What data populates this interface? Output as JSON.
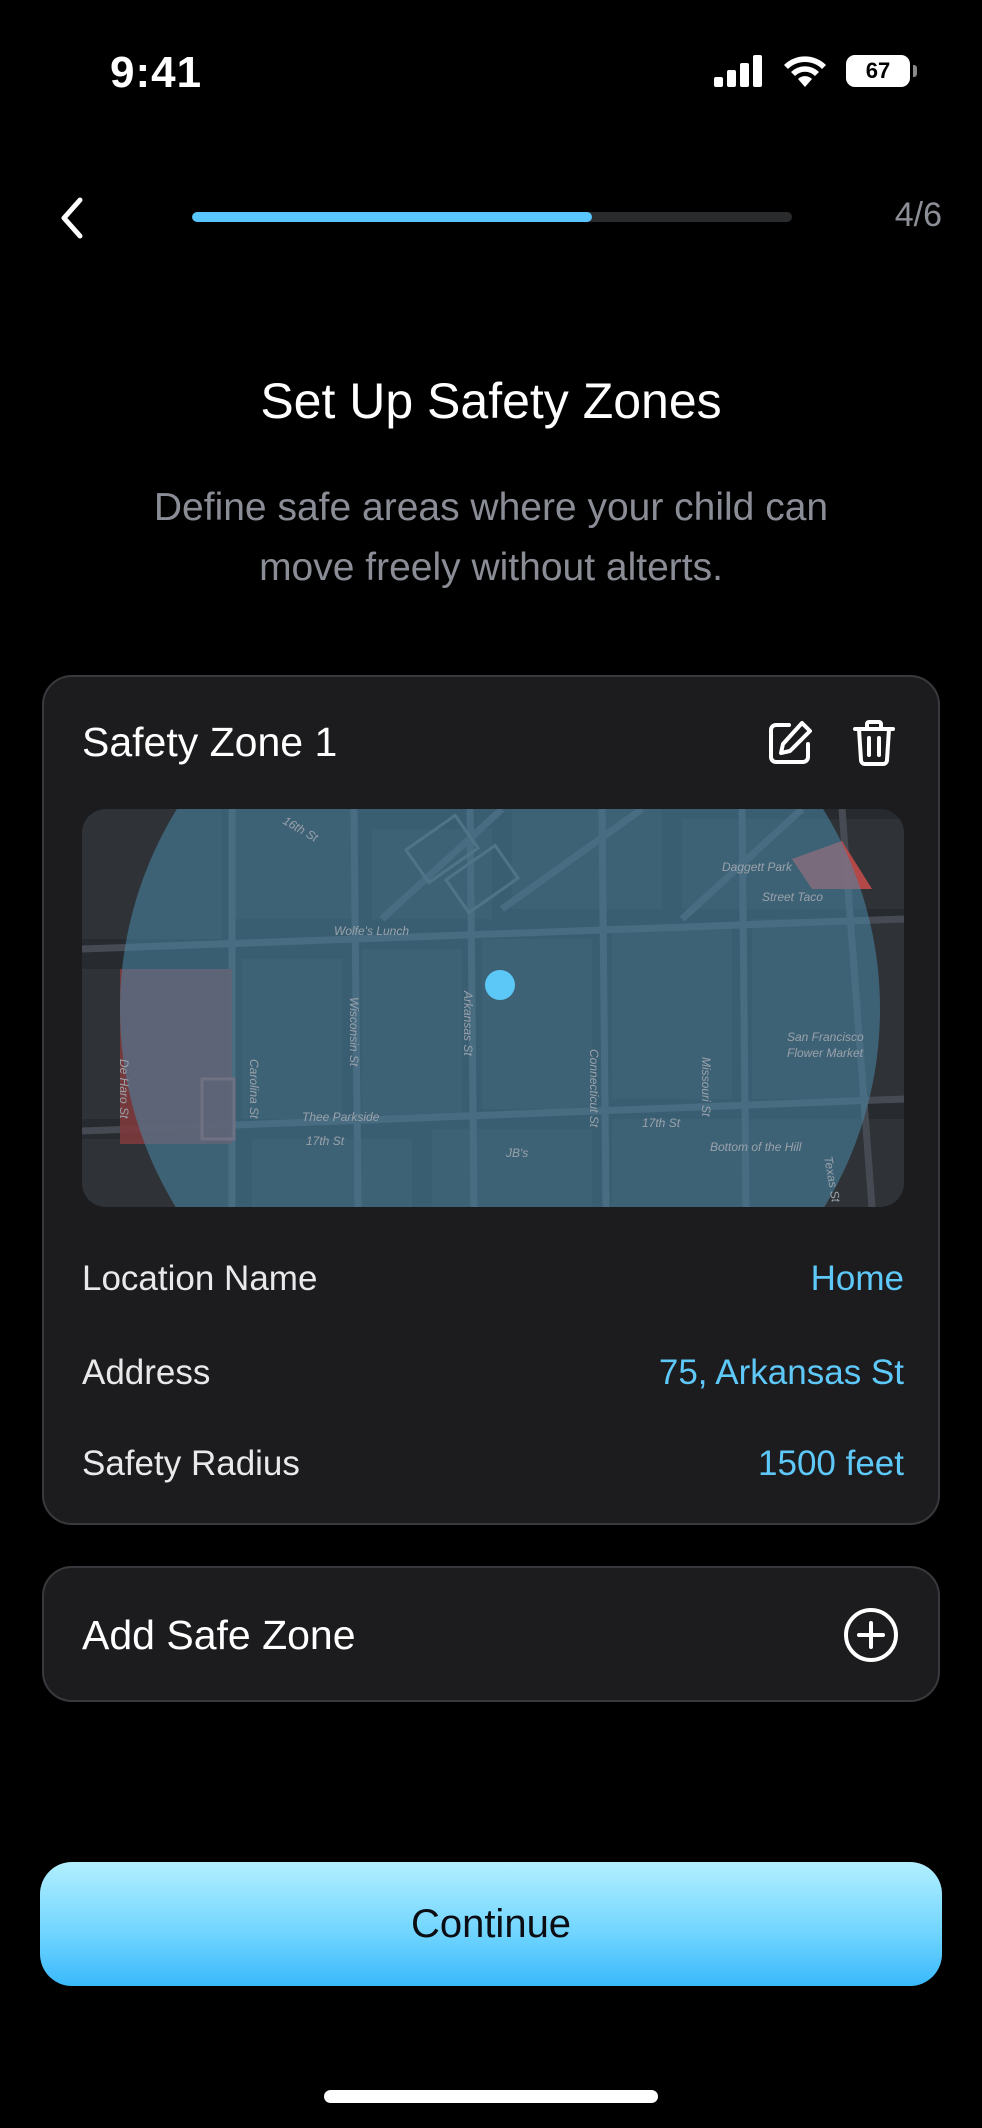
{
  "status_bar": {
    "time": "9:41",
    "battery_level": "67",
    "icons": [
      "signal-icon",
      "wifi-icon",
      "battery-icon"
    ]
  },
  "header": {
    "back_icon": "chevron-left-icon",
    "progress_fraction": 0.667,
    "step_counter": "4/6"
  },
  "page": {
    "title": "Set Up Safety Zones",
    "subtitle": "Define safe areas where your child can move freely without alterts."
  },
  "zone": {
    "name": "Safety Zone 1",
    "edit_icon": "edit-icon",
    "delete_icon": "trash-icon",
    "map": {
      "street_labels": [
        "16th St",
        "Daggett Park",
        "Street Taco",
        "Wolfe's Lunch",
        "Wisconsin St",
        "Arkansas St",
        "Connecticut St",
        "Missouri St",
        "San Francisco Flower Market",
        "De Haro St",
        "Carolina St",
        "Thee Parkside",
        "17th St",
        "17th St",
        "JB's",
        "Bottom of the Hill",
        "Texas St"
      ]
    },
    "rows": [
      {
        "label": "Location Name",
        "value": "Home"
      },
      {
        "label": "Address",
        "value": "75, Arkansas St"
      },
      {
        "label": "Safety Radius",
        "value": "1500 feet"
      }
    ]
  },
  "add_zone": {
    "label": "Add Safe Zone",
    "icon": "plus-circle-icon"
  },
  "continue_button": {
    "label": "Continue"
  },
  "colors": {
    "accent": "#58c6ff",
    "value_text": "#5ec8f8",
    "card_bg": "#1c1c1e",
    "card_border": "#38393c",
    "background": "#000000"
  }
}
